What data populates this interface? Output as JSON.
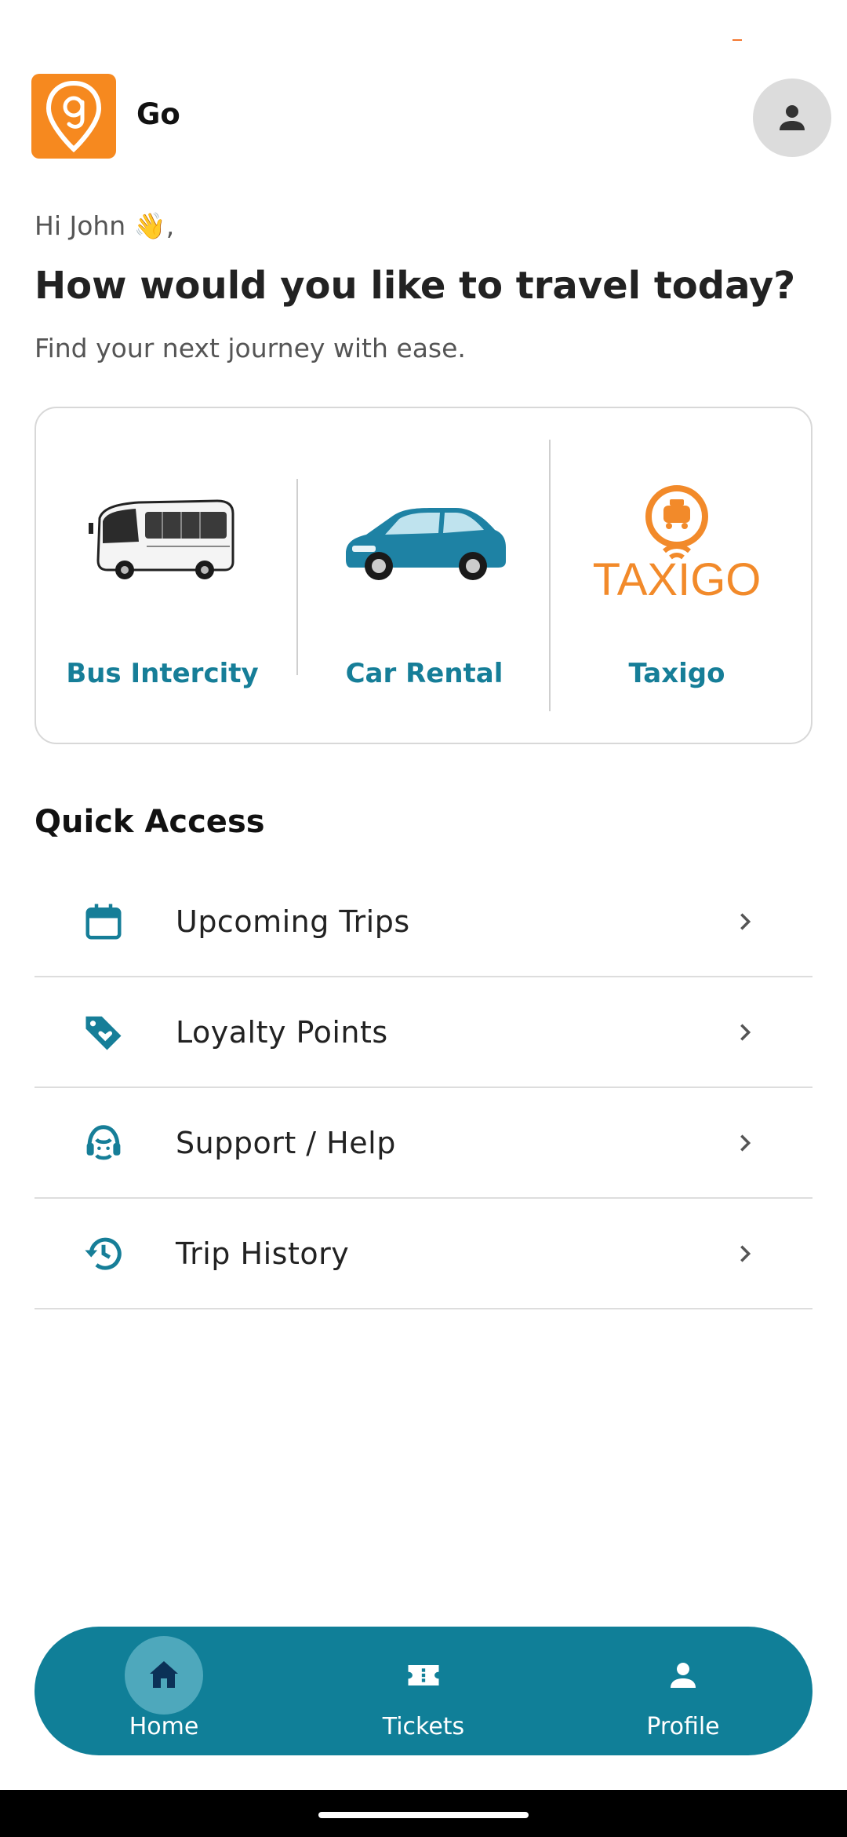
{
  "app": {
    "name": "Go"
  },
  "greeting": {
    "hello": "Hi John 👋,",
    "headline": "How would you like to travel today?",
    "subline": "Find your next journey with ease."
  },
  "services": [
    {
      "label": "Bus Intercity",
      "icon": "bus-image"
    },
    {
      "label": "Car Rental",
      "icon": "car-image"
    },
    {
      "label": "Taxigo",
      "icon": "taxigo-logo",
      "logo_text": "TAXIGO"
    }
  ],
  "quick_access": {
    "title": "Quick Access",
    "items": [
      {
        "label": "Upcoming Trips",
        "icon": "calendar-icon"
      },
      {
        "label": "Loyalty Points",
        "icon": "tag-heart-icon"
      },
      {
        "label": "Support / Help",
        "icon": "support-agent-icon"
      },
      {
        "label": "Trip History",
        "icon": "history-icon"
      }
    ]
  },
  "nav": {
    "items": [
      {
        "label": "Home",
        "icon": "home-icon",
        "active": true
      },
      {
        "label": "Tickets",
        "icon": "ticket-icon",
        "active": false
      },
      {
        "label": "Profile",
        "icon": "person-icon",
        "active": false
      }
    ]
  },
  "colors": {
    "brand_orange": "#f6891f",
    "accent_teal": "#107f98",
    "label_teal": "#167e98"
  }
}
